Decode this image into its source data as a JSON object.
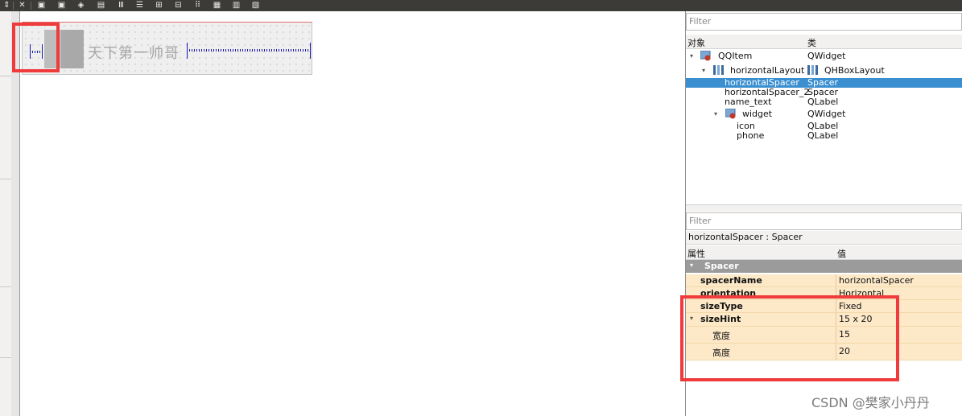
{
  "object_filter": {
    "placeholder": "Filter"
  },
  "object_tree": {
    "col_object": "对象",
    "col_class": "类",
    "rows": [
      {
        "name": "QQItem",
        "class": "QWidget"
      },
      {
        "name": "horizontalLayout",
        "class": "QHBoxLayout"
      },
      {
        "name": "horizontalSpacer",
        "class": "Spacer"
      },
      {
        "name": "horizontalSpacer_2",
        "class": "Spacer"
      },
      {
        "name": "name_text",
        "class": "QLabel"
      },
      {
        "name": "widget",
        "class": "QWidget"
      },
      {
        "name": "icon",
        "class": "QLabel"
      },
      {
        "name": "phone",
        "class": "QLabel"
      }
    ]
  },
  "property_filter": {
    "placeholder": "Filter"
  },
  "property_editor": {
    "title": "horizontalSpacer : Spacer",
    "col_property": "属性",
    "col_value": "值",
    "category": "Spacer",
    "rows": [
      {
        "key": "spacerName",
        "value": "horizontalSpacer"
      },
      {
        "key": "orientation",
        "value": "Horizontal"
      },
      {
        "key": "sizeType",
        "value": "Fixed"
      },
      {
        "key": "sizeHint",
        "value": "15 x 20"
      },
      {
        "key": "宽度",
        "value": "15"
      },
      {
        "key": "高度",
        "value": "20"
      }
    ]
  },
  "canvas": {
    "name_text": "天下第一帅哥"
  },
  "watermark": "CSDN @樊家小丹丹",
  "colors": {
    "selection": "#3a8fd0",
    "highlight": "#ef3b3b",
    "property_row": "#fde9c8",
    "spacer": "#1a1aa8"
  }
}
